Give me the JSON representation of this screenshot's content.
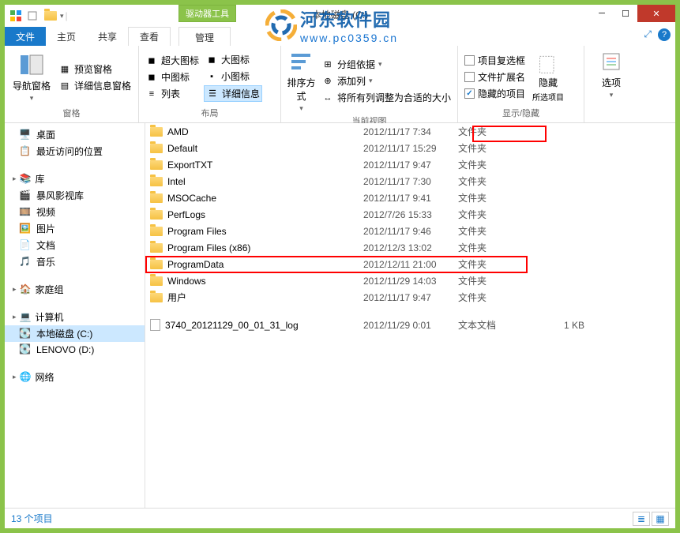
{
  "window": {
    "title": "本地磁盘 (C:)",
    "extra_tab": "驱动器工具",
    "minimize": "─",
    "maximize": "☐",
    "close": "✕"
  },
  "tabs": {
    "file": "文件",
    "home": "主页",
    "share": "共享",
    "view": "查看",
    "manage": "管理"
  },
  "ribbon": {
    "panes": {
      "nav": "导航窗格",
      "preview": "预览窗格",
      "details": "详细信息窗格",
      "group_label": "窗格"
    },
    "layout": {
      "xl": "超大图标",
      "l": "大图标",
      "m": "中图标",
      "s": "小图标",
      "list": "列表",
      "det": "详细信息",
      "group_label": "布局"
    },
    "currentview": {
      "sort": "排序方式",
      "groupby": "分组依据",
      "addcol": "添加列",
      "fitcols": "将所有列调整为合适的大小",
      "group_label": "当前视图"
    },
    "showhide": {
      "chk1": "项目复选框",
      "chk2": "文件扩展名",
      "chk3": "隐藏的项目",
      "hide": "隐藏",
      "hide_sub": "所选项目",
      "group_label": "显示/隐藏"
    },
    "options": "选项"
  },
  "nav": {
    "desktop": "桌面",
    "recent": "最近访问的位置",
    "libraries": "库",
    "baofeng": "暴风影视库",
    "videos": "视频",
    "pictures": "图片",
    "documents": "文档",
    "music": "音乐",
    "homegroup": "家庭组",
    "computer": "计算机",
    "drive_c": "本地磁盘 (C:)",
    "drive_d": "LENOVO (D:)",
    "network": "网络"
  },
  "files": [
    {
      "name": "AMD",
      "date": "2012/11/17 7:34",
      "type": "文件夹",
      "size": ""
    },
    {
      "name": "Default",
      "date": "2012/11/17 15:29",
      "type": "文件夹",
      "size": ""
    },
    {
      "name": "ExportTXT",
      "date": "2012/11/17 9:47",
      "type": "文件夹",
      "size": ""
    },
    {
      "name": "Intel",
      "date": "2012/11/17 7:30",
      "type": "文件夹",
      "size": ""
    },
    {
      "name": "MSOCache",
      "date": "2012/11/17 9:41",
      "type": "文件夹",
      "size": ""
    },
    {
      "name": "PerfLogs",
      "date": "2012/7/26 15:33",
      "type": "文件夹",
      "size": ""
    },
    {
      "name": "Program Files",
      "date": "2012/11/17 9:46",
      "type": "文件夹",
      "size": ""
    },
    {
      "name": "Program Files (x86)",
      "date": "2012/12/3 13:02",
      "type": "文件夹",
      "size": ""
    },
    {
      "name": "ProgramData",
      "date": "2012/12/11 21:00",
      "type": "文件夹",
      "size": ""
    },
    {
      "name": "Windows",
      "date": "2012/11/29 14:03",
      "type": "文件夹",
      "size": ""
    },
    {
      "name": "用户",
      "date": "2012/11/17 9:47",
      "type": "文件夹",
      "size": ""
    },
    {
      "name": "3740_20121129_00_01_31_log",
      "date": "2012/11/29 0:01",
      "type": "文本文档",
      "size": "1 KB"
    }
  ],
  "status": {
    "count": "13 个项目"
  },
  "watermark": {
    "line1": "河东软件园",
    "line2": "www.pc0359.cn"
  }
}
